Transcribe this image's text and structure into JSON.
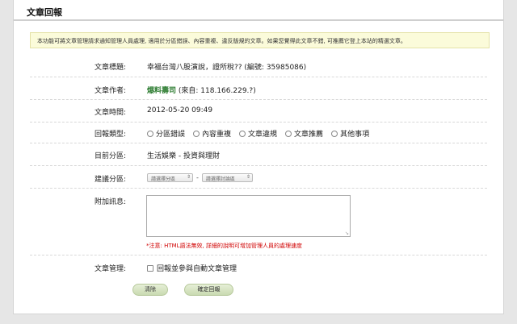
{
  "page": {
    "title": "文章回報"
  },
  "notice": "本功能可將文章管理請求通知管理人員處理, 適用於分區錯誤、內容重複、違反版規的文章。如果您覺得此文章不錯, 可推薦它登上本站的精選文章。",
  "fields": {
    "article_title": {
      "label": "文章標題:",
      "value": "幸福台灣八股演說，證所稅?? (編號: 35985086)"
    },
    "article_author": {
      "label": "文章作者:",
      "name": "爆料壽司",
      "source": "(來自: 118.166.229.?)"
    },
    "article_time": {
      "label": "文章時間:",
      "value": "2012-05-20 09:49"
    },
    "report_type": {
      "label": "回報類型:",
      "options": [
        "分區錯誤",
        "內容重複",
        "文章違規",
        "文章推薦",
        "其他事項"
      ]
    },
    "current_zone": {
      "label": "目前分區:",
      "value": "生活娛樂 - 投資與理財"
    },
    "suggest_zone": {
      "label": "建議分區:",
      "zone_placeholder": "請選擇分區",
      "dash": "-",
      "board_placeholder": "請選擇討論區"
    },
    "message": {
      "label": "附加訊息:",
      "warning": "*注意: HTML語法無效, 詳細的說明可增加管理人員的處理速度"
    },
    "manage": {
      "label": "文章管理:",
      "checkbox_label": "回報並參與自動文章管理"
    }
  },
  "buttons": {
    "clear": "清除",
    "submit": "確定回報"
  }
}
